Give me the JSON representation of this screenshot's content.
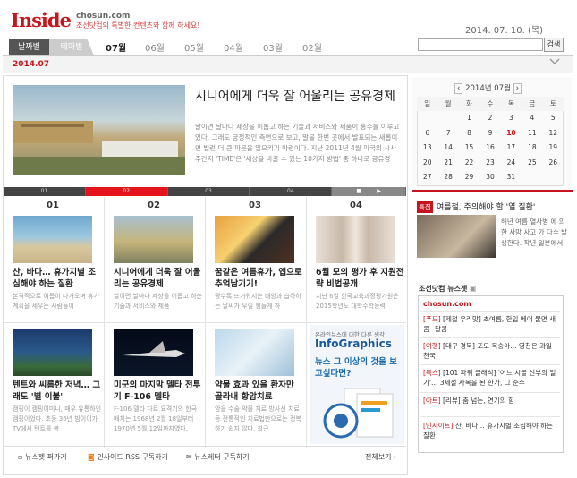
{
  "header": {
    "logo": "Inside",
    "site": "chosun.com",
    "slogan": "조선닷컴의 특별한 컨텐츠와 함께 하세요!",
    "date": "2014. 07. 10. (목)",
    "search_button": "검색",
    "search_value": ""
  },
  "tabs": [
    {
      "label": "날짜별"
    },
    {
      "label": "테마별"
    }
  ],
  "months": [
    "07월",
    "06월",
    "05월",
    "04월",
    "03월",
    "02월"
  ],
  "period_label": "2014.07",
  "hero": {
    "title": "시니어에게 더욱 잘 어울리는 공유경제",
    "desc": "날이면 날마다 세상을 이롭고 하는 기술과 서비스와 제품이 홍수를 이루고 있다. 그래도 궁정적인 측면으로 보고, 말을 한번 곳에서 발표되는 새롭이면 빌런 더 큰 파문을 일으키기 마련이다. 지난 2011년 4월 미국의 시사 주간지 'TIME'은 '세상을 바꿀 수 있는 10가지 방법' 중 하나로 공유경"
  },
  "slider": {
    "items": [
      "01",
      "02",
      "03",
      "04"
    ],
    "active": 1
  },
  "cards_row1": [
    {
      "num": "01",
      "title": "산, 바다… 휴가지별 조심해야 하는 질환",
      "desc": "본격적으로 여름이 다가오며 휴가계획을 세우는 사람들이"
    },
    {
      "num": "02",
      "title": "시니어에게 더욱 잘 어울리는 공유경제",
      "desc": "날이면 날마다 세상을 이롭고 하는 기술과 서비스와 제품"
    },
    {
      "num": "03",
      "title": "꿈같은 여름휴가, 앱으로 추억남기기!",
      "desc": "광수록 뜨거워지는 태양과 습하하는 날씨가 우릴 힘들게 하"
    },
    {
      "num": "04",
      "title": "6월 모의 평가 후 지원전략 비법공개",
      "desc": "지난 6일 한국교육과정평가원은 2015학년도 대학수학능력"
    }
  ],
  "cards_row2": [
    {
      "title": "텐트와 씨름한 저녁… 그래도 '별 이불'",
      "desc": "캠핑이 캠핑이미니, 매우 유통하인 캠핑이었다. 초등 36년 밤이이가 TV에서 텐트를 봉"
    },
    {
      "title": "미군의 마지막 델타 전투기 F-106 델타",
      "desc": "F-106 델타 다트 요격기의 한국 배치는 1968년 2월 18일부터 1970년 5월 12일까지였다."
    },
    {
      "title": "약물 효과 있을 환자만 골라내 항암치료",
      "desc": "암을 수술 약물 치료 방사선 치료 등 전통적인 치료법만으로는 정복하기 쉽지 않다. 최근"
    },
    {
      "ad_line1": "온라인뉴스에 대한 다른 생각",
      "ad_title": "InfoGraphics",
      "ad_sub": "뉴스 그 이상의 것을 보고싶다면?"
    }
  ],
  "footer": {
    "links": [
      "뉴스젯 퍼가기",
      "인사이드 RSS 구독하기",
      "뉴스레터 구독하기"
    ],
    "more": "전체보기"
  },
  "calendar": {
    "title": "2014년 07월",
    "weekdays": [
      "일",
      "월",
      "화",
      "수",
      "목",
      "금",
      "토"
    ],
    "days": [
      "",
      "",
      "1",
      "2",
      "3",
      "4",
      "5",
      "6",
      "7",
      "8",
      "9",
      "10",
      "11",
      "12",
      "13",
      "14",
      "15",
      "16",
      "17",
      "18",
      "19",
      "20",
      "21",
      "22",
      "23",
      "24",
      "25",
      "26",
      "27",
      "28",
      "29",
      "30",
      "31",
      "",
      ""
    ],
    "today": "10",
    "today_color": "#c4161c"
  },
  "featured": {
    "badge": "특집",
    "title": "여름철, 주의해야 할 '열 질환'",
    "desc": "해년 여름 열사병 에 의한 사망 사고 가 다수 발생한다. 작년 일본에서"
  },
  "newsletter": {
    "heading": "조선닷컴 뉴스젯",
    "logo": "chosun.com",
    "items": [
      {
        "tag": "[푸드]",
        "text": " [제철 우리맛] 초여름, 한입 베어 물면 새콤~달콤~"
      },
      {
        "tag": "[여행]",
        "text": " [대구 경북] 포도 복숭아… 영천은 과일 천국"
      },
      {
        "tag": "[북스]",
        "text": " [101 파워 클래식] '어느 시골 신부의 일기'… 3제절 사목을 된 한가, 그 순수"
      },
      {
        "tag": "[아트]",
        "text": " [리뷰] 춤 넘는, 연기의 힘"
      },
      {
        "tag": "[인사이트]",
        "text": " 산, 바다… 휴가지별 조심해야 하는 질환"
      }
    ]
  },
  "colors": {
    "brand": "#c4161c"
  }
}
